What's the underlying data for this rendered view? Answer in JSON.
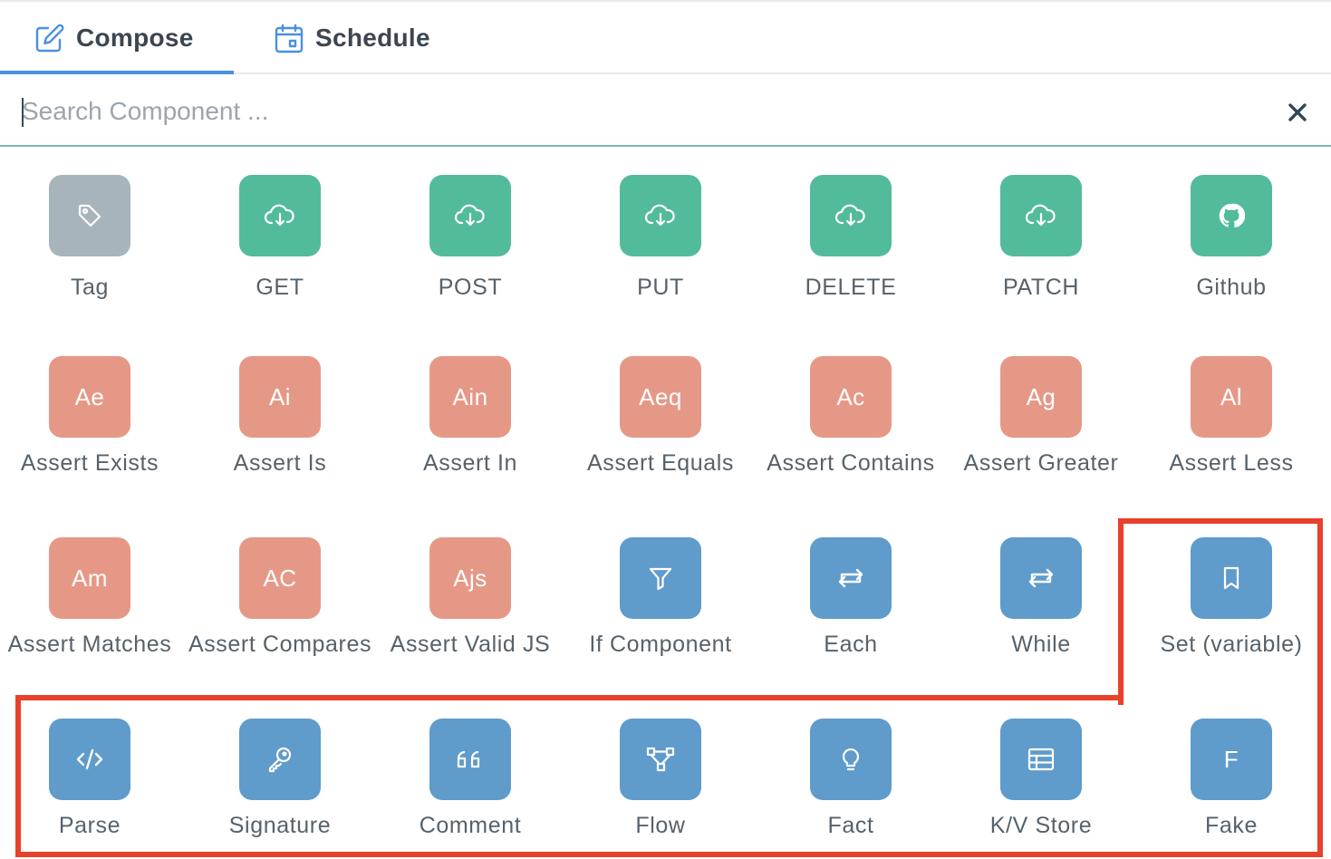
{
  "tabs": {
    "compose": {
      "label": "Compose",
      "icon": "pencil-square-icon",
      "active": true
    },
    "schedule": {
      "label": "Schedule",
      "icon": "calendar-icon",
      "active": false
    }
  },
  "search": {
    "placeholder": "Search Component ...",
    "value": "",
    "clear_icon": "close-icon"
  },
  "colors": {
    "accent": "#4a90e2",
    "highlight": "#e8412c",
    "gray": "#a8b4bb",
    "green": "#52bb9c",
    "salmon": "#e69887",
    "blue": "#5f9bcb"
  },
  "components": [
    {
      "label": "Tag",
      "icon": "tag-icon",
      "color": "gray"
    },
    {
      "label": "GET",
      "icon": "cloud-download-icon",
      "color": "green"
    },
    {
      "label": "POST",
      "icon": "cloud-download-icon",
      "color": "green"
    },
    {
      "label": "PUT",
      "icon": "cloud-download-icon",
      "color": "green"
    },
    {
      "label": "DELETE",
      "icon": "cloud-download-icon",
      "color": "green"
    },
    {
      "label": "PATCH",
      "icon": "cloud-download-icon",
      "color": "green"
    },
    {
      "label": "Github",
      "icon": "github-icon",
      "color": "green"
    },
    {
      "label": "Assert Exists",
      "abbr": "Ae",
      "color": "salmon"
    },
    {
      "label": "Assert Is",
      "abbr": "Ai",
      "color": "salmon"
    },
    {
      "label": "Assert In",
      "abbr": "Ain",
      "color": "salmon"
    },
    {
      "label": "Assert Equals",
      "abbr": "Aeq",
      "color": "salmon"
    },
    {
      "label": "Assert Contains",
      "abbr": "Ac",
      "color": "salmon"
    },
    {
      "label": "Assert Greater",
      "abbr": "Ag",
      "color": "salmon"
    },
    {
      "label": "Assert Less",
      "abbr": "Al",
      "color": "salmon"
    },
    {
      "label": "Assert Matches",
      "abbr": "Am",
      "color": "salmon"
    },
    {
      "label": "Assert Compares",
      "abbr": "AC",
      "color": "salmon"
    },
    {
      "label": "Assert Valid JS",
      "abbr": "Ajs",
      "color": "salmon"
    },
    {
      "label": "If Component",
      "icon": "filter-icon",
      "color": "blue"
    },
    {
      "label": "Each",
      "icon": "repeat-icon",
      "color": "blue"
    },
    {
      "label": "While",
      "icon": "repeat-icon",
      "color": "blue"
    },
    {
      "label": "Set (variable)",
      "icon": "bookmark-icon",
      "color": "blue"
    },
    {
      "label": "Parse",
      "icon": "code-icon",
      "color": "blue"
    },
    {
      "label": "Signature",
      "icon": "key-icon",
      "color": "blue"
    },
    {
      "label": "Comment",
      "icon": "quote-icon",
      "color": "blue"
    },
    {
      "label": "Flow",
      "icon": "flow-icon",
      "color": "blue"
    },
    {
      "label": "Fact",
      "icon": "lightbulb-icon",
      "color": "blue"
    },
    {
      "label": "K/V Store",
      "icon": "table-icon",
      "color": "blue"
    },
    {
      "label": "Fake",
      "abbr": "F",
      "color": "blue"
    }
  ]
}
